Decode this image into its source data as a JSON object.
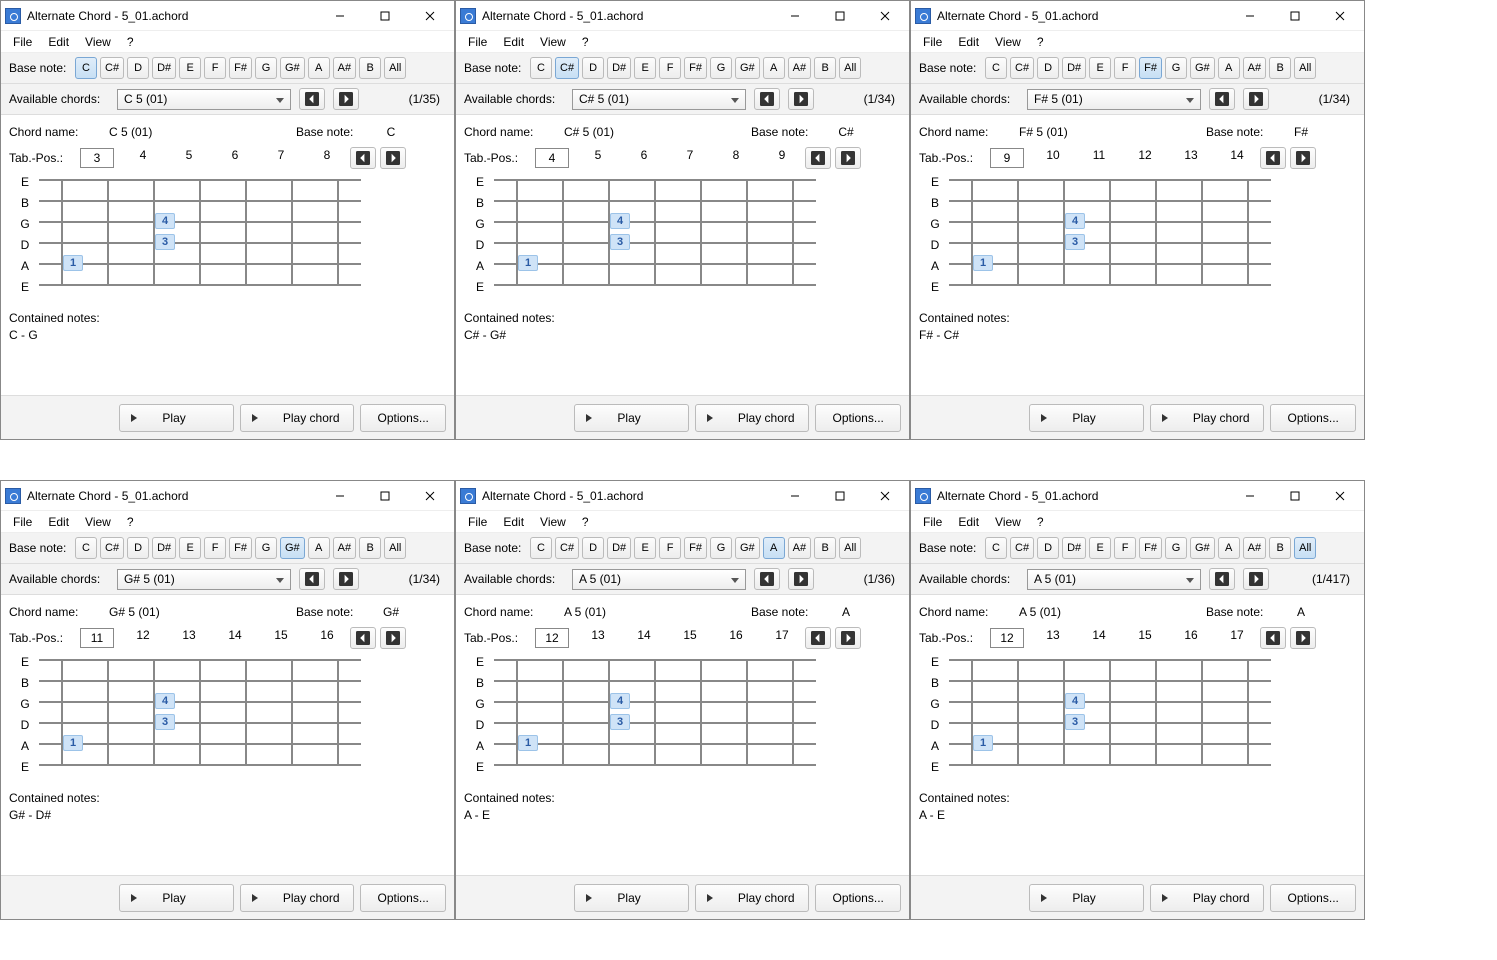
{
  "common": {
    "title": "Alternate Chord - 5_01.achord",
    "menu": {
      "file": "File",
      "edit": "Edit",
      "view": "View",
      "help": "?"
    },
    "baseNoteLbl": "Base note:",
    "availLbl": "Available chords:",
    "chordNameLbl": "Chord name:",
    "baseNoteLbl2": "Base note:",
    "tabPosLbl": "Tab.-Pos.:",
    "containedLbl": "Contained notes:",
    "playLbl": "Play",
    "playChordLbl": "Play chord",
    "optionsLbl": "Options...",
    "notes": [
      "C",
      "C#",
      "D",
      "D#",
      "E",
      "F",
      "F#",
      "G",
      "G#",
      "A",
      "A#",
      "B",
      "All"
    ],
    "strings": [
      "E",
      "B",
      "G",
      "D",
      "A",
      "E"
    ]
  },
  "wins": [
    {
      "sel": "C",
      "dd": "C 5 (01)",
      "counter": "(1/35)",
      "chord": "C 5 (01)",
      "bnote": "C",
      "tpos": "3",
      "frets": [
        "3",
        "4",
        "5",
        "6",
        "7",
        "8"
      ],
      "fingers": [
        {
          "s": 4,
          "f": 0,
          "n": "1"
        },
        {
          "s": 3,
          "f": 2,
          "n": "3"
        },
        {
          "s": 2,
          "f": 2,
          "n": "4"
        }
      ],
      "contained": "C - G"
    },
    {
      "sel": "C#",
      "dd": "C# 5 (01)",
      "counter": "(1/34)",
      "chord": "C# 5 (01)",
      "bnote": "C#",
      "tpos": "4",
      "frets": [
        "4",
        "5",
        "6",
        "7",
        "8",
        "9"
      ],
      "fingers": [
        {
          "s": 4,
          "f": 0,
          "n": "1"
        },
        {
          "s": 3,
          "f": 2,
          "n": "3"
        },
        {
          "s": 2,
          "f": 2,
          "n": "4"
        }
      ],
      "contained": "C# - G#"
    },
    {
      "sel": "F#",
      "dd": "F# 5 (01)",
      "counter": "(1/34)",
      "chord": "F# 5 (01)",
      "bnote": "F#",
      "tpos": "9",
      "frets": [
        "9",
        "10",
        "11",
        "12",
        "13",
        "14"
      ],
      "fingers": [
        {
          "s": 4,
          "f": 0,
          "n": "1"
        },
        {
          "s": 3,
          "f": 2,
          "n": "3"
        },
        {
          "s": 2,
          "f": 2,
          "n": "4"
        }
      ],
      "contained": "F# - C#"
    },
    {
      "sel": "G#",
      "dd": "G# 5 (01)",
      "counter": "(1/34)",
      "chord": "G# 5 (01)",
      "bnote": "G#",
      "tpos": "11",
      "frets": [
        "11",
        "12",
        "13",
        "14",
        "15",
        "16"
      ],
      "fingers": [
        {
          "s": 4,
          "f": 0,
          "n": "1"
        },
        {
          "s": 3,
          "f": 2,
          "n": "3"
        },
        {
          "s": 2,
          "f": 2,
          "n": "4"
        }
      ],
      "contained": "G# - D#"
    },
    {
      "sel": "A",
      "dd": "A 5 (01)",
      "counter": "(1/36)",
      "chord": "A 5 (01)",
      "bnote": "A",
      "tpos": "12",
      "frets": [
        "12",
        "13",
        "14",
        "15",
        "16",
        "17"
      ],
      "fingers": [
        {
          "s": 4,
          "f": 0,
          "n": "1"
        },
        {
          "s": 3,
          "f": 2,
          "n": "3"
        },
        {
          "s": 2,
          "f": 2,
          "n": "4"
        }
      ],
      "contained": "A - E"
    },
    {
      "sel": "All",
      "dd": "A 5 (01)",
      "counter": "(1/417)",
      "chord": "A 5 (01)",
      "bnote": "A",
      "tpos": "12",
      "frets": [
        "12",
        "13",
        "14",
        "15",
        "16",
        "17"
      ],
      "fingers": [
        {
          "s": 4,
          "f": 0,
          "n": "1"
        },
        {
          "s": 3,
          "f": 2,
          "n": "3"
        },
        {
          "s": 2,
          "f": 2,
          "n": "4"
        }
      ],
      "contained": "A - E"
    }
  ]
}
